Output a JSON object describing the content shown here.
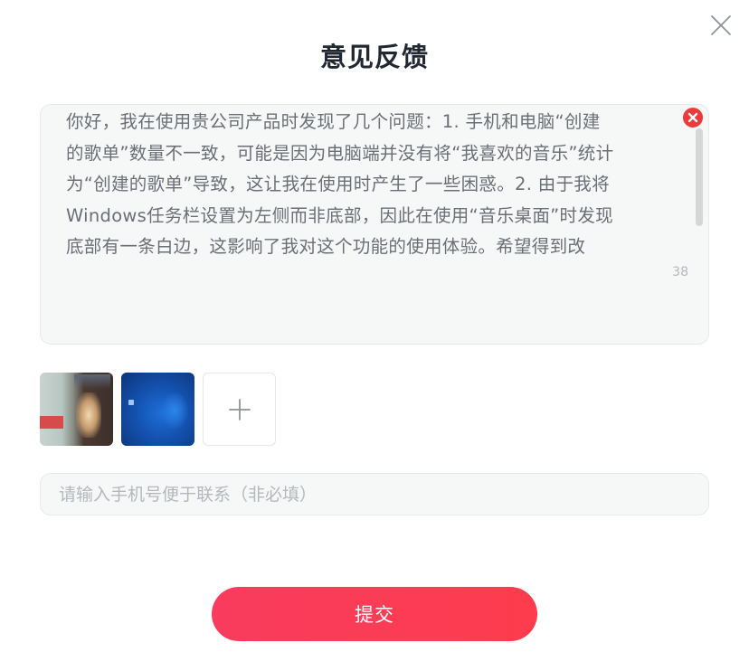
{
  "dialog": {
    "title": "意见反馈",
    "close_icon": "close-icon"
  },
  "feedback": {
    "text": "你好，我在使用贵公司产品时发现了几个问题：1. 手机和电脑“创建\n的歌单”数量不一致，可能是因为电脑端并没有将“我喜欢的音乐”统计\n为“创建的歌单”导致，这让我在使用时产生了一些困惑。2. 由于我将\nWindows任务栏设置为左侧而非底部，因此在使用“音乐桌面”时发现\n底部有一条白边，这影响了我对这个功能的使用体验。希望得到改",
    "char_count": "38",
    "clear_icon": "clear-circle-icon"
  },
  "attachments": {
    "images": [
      {
        "name": "screenshot-thumbnail-1"
      },
      {
        "name": "screenshot-thumbnail-2"
      }
    ],
    "add_icon": "plus-icon"
  },
  "contact": {
    "placeholder": "请输入手机号便于联系（非必填）",
    "value": ""
  },
  "submit": {
    "label": "提交"
  },
  "colors": {
    "accent": "#fd3c4d",
    "clear_icon": "#ee3a3a",
    "title": "#222831",
    "text": "#6b6f75",
    "placeholder": "#b4b8bc"
  }
}
